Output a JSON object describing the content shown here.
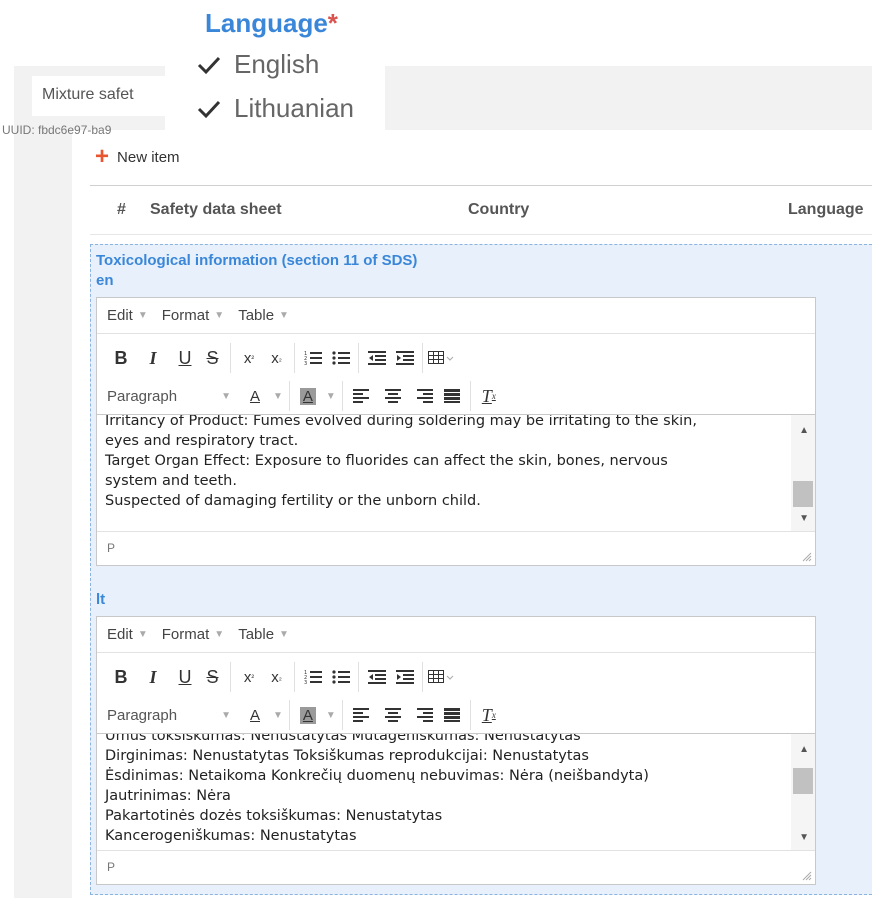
{
  "header": {
    "title_partial": "Mixture safet",
    "uuid_partial": "UUID: fbdc6e97-ba9"
  },
  "language_popup": {
    "title": "Language",
    "required_mark": "*",
    "options": [
      {
        "label": "English",
        "checked": true
      },
      {
        "label": "Lithuanian",
        "checked": true
      }
    ]
  },
  "toolbar": {
    "new_item_label": "New item"
  },
  "table": {
    "columns": [
      "#",
      "Safety data sheet",
      "Country",
      "Language"
    ]
  },
  "section": {
    "title": "Toxicological information (section 11 of SDS)",
    "editors": [
      {
        "lang": "en",
        "lines": [
          "Irritancy of Product: Fumes evolved during soldering may be irritating to the skin,",
          "eyes and respiratory tract.",
          "Target Organ Effect: Exposure to fluorides can affect the skin, bones, nervous",
          "system and teeth.",
          "Suspected of damaging fertility or the unborn child."
        ],
        "status": "P"
      },
      {
        "lang": "lt",
        "lines": [
          "Ūmus toksiškumas: Nenustatytas Mutageniškumas: Nenustatytas",
          "Dirginimas: Nenustatytas Toksiškumas reprodukcijai: Nenustatytas",
          "Ėsdinimas: Netaikoma Konkrečių duomenų nebuvimas: Nėra (neišbandyta)",
          "Jautrinimas: Nėra",
          "Pakartotinės dozės toksiškumas: Nenustatytas",
          "Kancerogeniškumas: Nenustatytas"
        ],
        "status": "P"
      }
    ]
  },
  "editor_ui": {
    "menu": [
      "Edit",
      "Format",
      "Table"
    ],
    "paragraph_label": "Paragraph"
  },
  "colors": {
    "accent": "#3a86d9",
    "required": "#d9534f",
    "plus": "#e8552f",
    "section_bg": "#e8f1fb"
  }
}
